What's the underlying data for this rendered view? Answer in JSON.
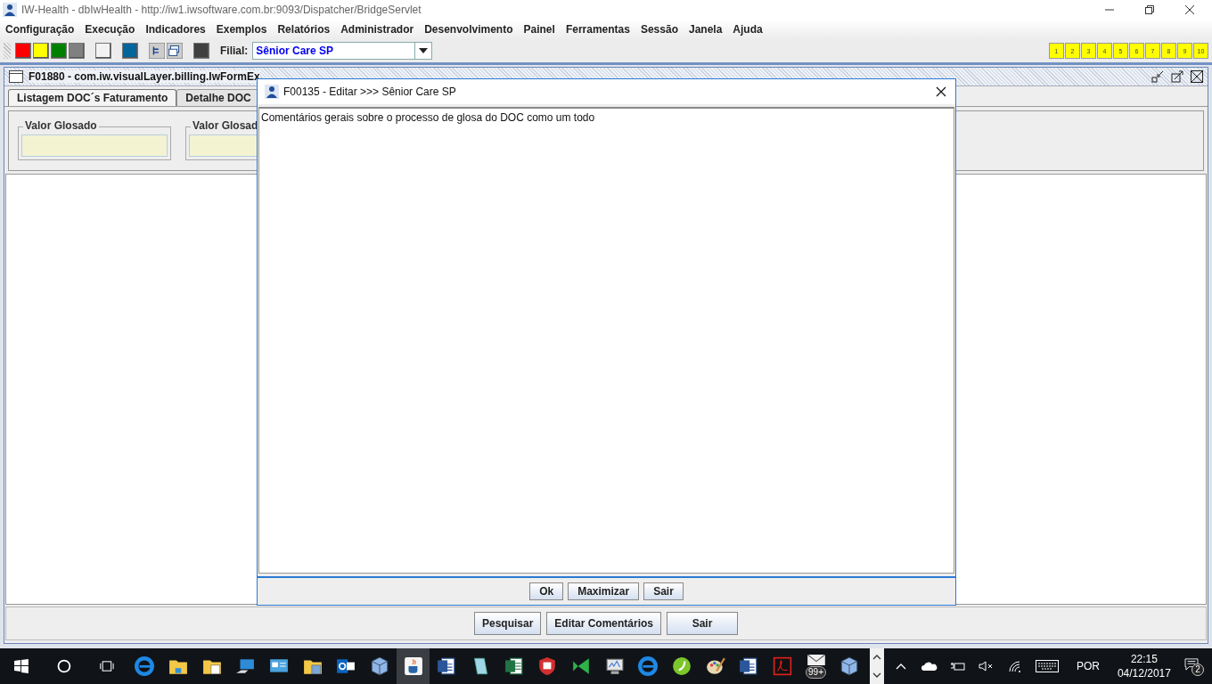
{
  "window": {
    "title": "IW-Health - dbIwHealth - http://iw1.iwsoftware.com.br:9093/Dispatcher/BridgeServlet"
  },
  "menu": [
    "Configuração",
    "Execução",
    "Indicadores",
    "Exemplos",
    "Relatórios",
    "Administrador",
    "Desenvolvimento",
    "Painel",
    "Ferramentas",
    "Sessão",
    "Janela",
    "Ajuda"
  ],
  "toolbar": {
    "swatches": [
      {
        "color": "#ff0000"
      },
      {
        "color": "#ffff00"
      },
      {
        "color": "#008000"
      },
      {
        "color": "#808080"
      },
      {
        "color": "#f2f2f2"
      },
      {
        "color": "#00669c"
      }
    ],
    "dark_swatch": {
      "color": "#404040"
    },
    "filial_label": "Filial:",
    "filial_value": "Sênior Care SP",
    "quick_buttons": [
      "1",
      "2",
      "3",
      "4",
      "5",
      "6",
      "7",
      "8",
      "9",
      "10"
    ]
  },
  "frame": {
    "title": "F01880 - com.iw.visualLayer.billing.IwFormEx",
    "tabs": [
      {
        "label": "Listagem DOC´s Faturamento",
        "selected": true
      },
      {
        "label": "Detalhe DOC",
        "selected": false
      }
    ],
    "fields": [
      {
        "label": "Valor Glosado"
      },
      {
        "label": "Valor Glosad"
      }
    ],
    "buttons": [
      "Pesquisar",
      "Editar Comentários",
      "Sair"
    ]
  },
  "dialog": {
    "title": "F00135 - Editar >>> Sênior Care SP",
    "text": "Comentários gerais sobre o processo de glosa do DOC como um todo",
    "buttons": [
      "Ok",
      "Maximizar",
      "Sair"
    ]
  },
  "taskbar": {
    "mail_badge": "99+",
    "language": "POR",
    "time": "22:15",
    "date": "04/12/2017",
    "notification_count": "2"
  }
}
